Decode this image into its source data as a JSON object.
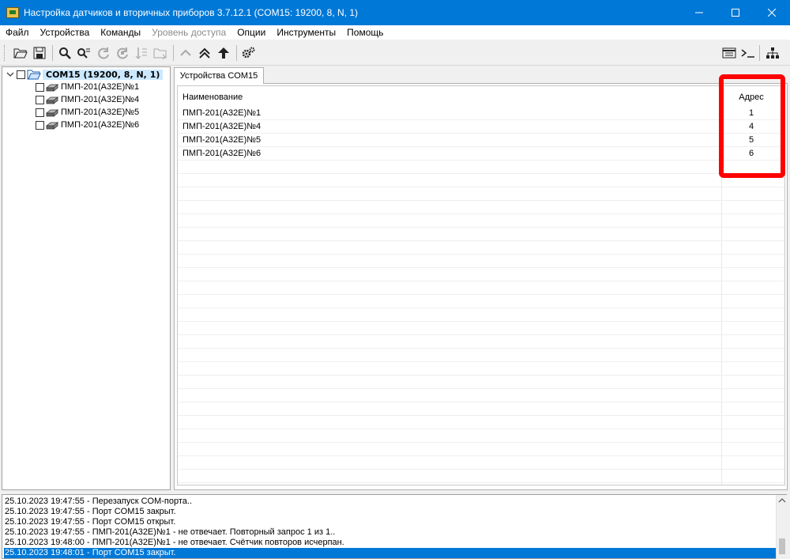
{
  "window": {
    "title": "Настройка датчиков и вторичных приборов 3.7.12.1 (COM15: 19200, 8, N, 1)",
    "accent": "#0078d7"
  },
  "menu": [
    "Файл",
    "Устройства",
    "Команды",
    "Уровень доступа",
    "Опции",
    "Инструменты",
    "Помощь"
  ],
  "toolbar": {
    "icons": [
      "open-folder-icon",
      "save-icon",
      "search-icon",
      "search-settings-icon",
      "refresh-icon",
      "refresh-all-icon",
      "sort-icon",
      "folder-move-icon",
      "chevron-up-icon",
      "double-chevron-up-icon",
      "arrow-up-icon",
      "gears-icon",
      "window-list-icon",
      "terminal-icon",
      "network-tree-icon"
    ]
  },
  "tree": {
    "root": "COM15 (19200, 8, N, 1)",
    "items": [
      "ПМП-201(А32Е)№1",
      "ПМП-201(А32Е)№4",
      "ПМП-201(А32Е)№5",
      "ПМП-201(А32Е)№6"
    ]
  },
  "tab": {
    "label": "Устройства COM15"
  },
  "grid": {
    "columns": [
      "Наименование",
      "Адрес"
    ],
    "rows": [
      {
        "name": "ПМП-201(А32Е)№1",
        "address": "1"
      },
      {
        "name": "ПМП-201(А32Е)№4",
        "address": "4"
      },
      {
        "name": "ПМП-201(А32Е)№5",
        "address": "5"
      },
      {
        "name": "ПМП-201(А32Е)№6",
        "address": "6"
      }
    ]
  },
  "highlight_color": "#ff0000",
  "log": [
    "25.10.2023 19:47:55 - Перезапуск COM-порта..",
    "25.10.2023 19:47:55 - Порт COM15 закрыт.",
    "25.10.2023 19:47:55 - Порт COM15 открыт.",
    "25.10.2023 19:47:55 - ПМП-201(А32Е)№1 - не отвечает. Повторный запрос 1 из 1..",
    "25.10.2023 19:48:00 - ПМП-201(А32Е)№1 - не отвечает. Счётчик повторов исчерпан.",
    "25.10.2023 19:48:01 - Порт COM15 закрыт."
  ]
}
